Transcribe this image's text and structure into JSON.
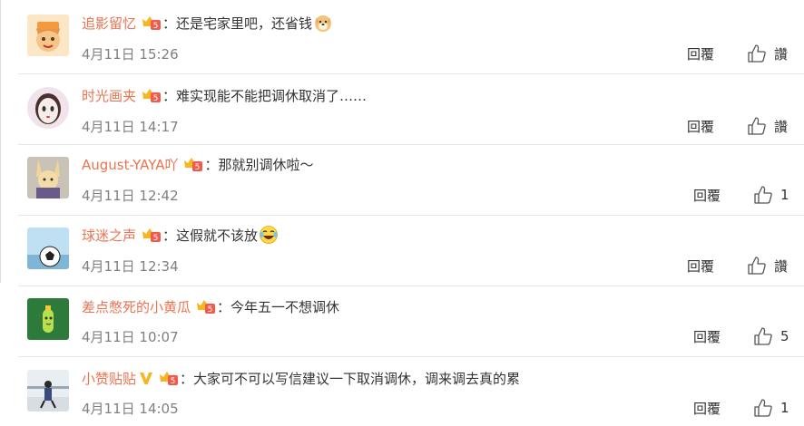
{
  "comments": [
    {
      "user": "追影留忆",
      "colon": "：",
      "text": "还是宅家里吧，还省钱",
      "emoji": "doge-icon",
      "date": "4月11日 15:26",
      "reply": "回覆",
      "likes": "讚"
    },
    {
      "user": "时光画夹",
      "colon": "：",
      "text": "难实现能不能把调休取消了……",
      "date": "4月11日 14:17",
      "reply": "回覆",
      "likes": "讚"
    },
    {
      "user": "August-YAYA吖",
      "colon": "：",
      "text": "那就别调休啦～",
      "date": "4月11日 12:42",
      "reply": "回覆",
      "likes": "1"
    },
    {
      "user": "球迷之声",
      "colon": "：",
      "text": "这假就不该放",
      "emoji": "laugh-cry-icon",
      "date": "4月11日 12:34",
      "reply": "回覆",
      "likes": "讚"
    },
    {
      "user": "差点憋死的小黄瓜",
      "colon": "：",
      "text": "今年五一不想调休",
      "date": "4月11日 10:07",
      "reply": "回覆",
      "likes": "5"
    },
    {
      "user": "小赞贴贴",
      "colon": "：",
      "text": "大家可不可以写信建议一下取消调休，调来调去真的累",
      "vip": "v-icon",
      "date": "4月11日 14:05",
      "reply": "回覆",
      "likes": "1"
    }
  ],
  "colors": {
    "username": "#eb7350",
    "text": "#333333",
    "date": "#808080",
    "badge": "#f25b4c"
  }
}
